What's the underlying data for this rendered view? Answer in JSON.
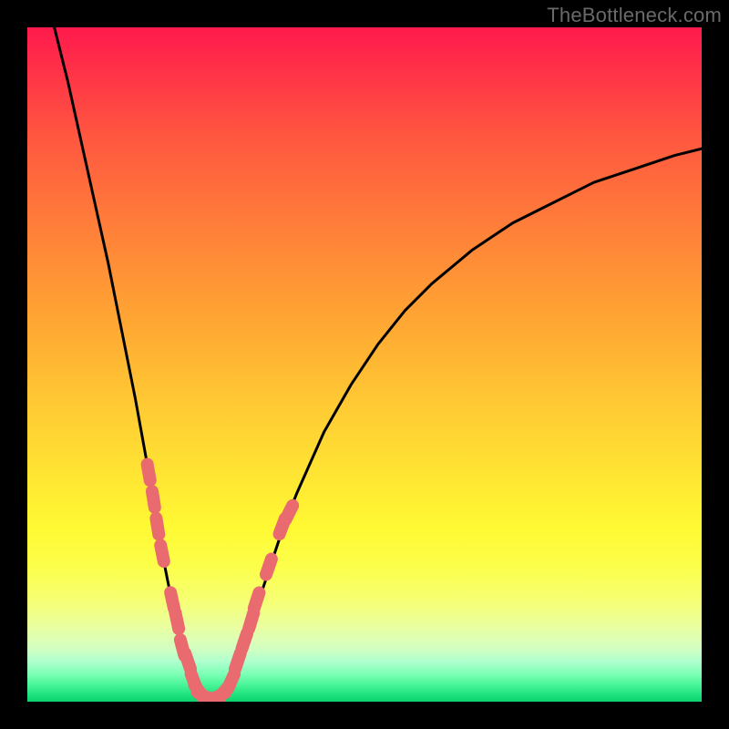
{
  "watermark_text": "TheBottleneck.com",
  "colors": {
    "frame": "#000000",
    "curve_stroke": "#000000",
    "marker_fill": "#e96a6f",
    "marker_stroke": "#c85155",
    "gradient_top": "#ff1a4d",
    "gradient_bottom": "#0cd371"
  },
  "chart_data": {
    "type": "line",
    "title": "",
    "xlabel": "",
    "ylabel": "",
    "xlim": [
      0,
      100
    ],
    "ylim": [
      0,
      100
    ],
    "legend": false,
    "grid": false,
    "note": "Axes unlabeled; values estimated from curve position. y is visual height within the gradient (0 = bottom/green, 100 = top/red).",
    "series": [
      {
        "name": "left-branch",
        "x": [
          4,
          6,
          8,
          10,
          12,
          14,
          16,
          18,
          19,
          20,
          21,
          22,
          23,
          24,
          25
        ],
        "y": [
          100,
          92,
          83,
          74,
          65,
          55,
          45,
          34,
          28,
          22,
          17,
          12,
          8,
          5,
          2
        ]
      },
      {
        "name": "valley",
        "x": [
          25,
          26,
          27,
          28,
          29,
          30
        ],
        "y": [
          2,
          1,
          0.5,
          0.5,
          1,
          2
        ]
      },
      {
        "name": "right-branch",
        "x": [
          30,
          32,
          34,
          36,
          38,
          40,
          44,
          48,
          52,
          56,
          60,
          66,
          72,
          78,
          84,
          90,
          96,
          100
        ],
        "y": [
          2,
          8,
          14,
          20,
          26,
          31,
          40,
          47,
          53,
          58,
          62,
          67,
          71,
          74,
          77,
          79,
          81,
          82
        ]
      }
    ],
    "markers": {
      "name": "highlighted-points",
      "note": "Pink capsule-shaped markers clustered near the valley on both branches.",
      "points": [
        {
          "x": 18.0,
          "y": 34
        },
        {
          "x": 18.7,
          "y": 30
        },
        {
          "x": 19.3,
          "y": 26
        },
        {
          "x": 20.0,
          "y": 22
        },
        {
          "x": 21.5,
          "y": 15
        },
        {
          "x": 22.2,
          "y": 12
        },
        {
          "x": 23.0,
          "y": 8
        },
        {
          "x": 23.8,
          "y": 6
        },
        {
          "x": 24.7,
          "y": 3
        },
        {
          "x": 25.5,
          "y": 1.5
        },
        {
          "x": 26.3,
          "y": 0.8
        },
        {
          "x": 27.3,
          "y": 0.5
        },
        {
          "x": 28.3,
          "y": 0.8
        },
        {
          "x": 29.2,
          "y": 1.5
        },
        {
          "x": 30.2,
          "y": 3
        },
        {
          "x": 31.2,
          "y": 6
        },
        {
          "x": 32.2,
          "y": 9
        },
        {
          "x": 33.2,
          "y": 12
        },
        {
          "x": 34.0,
          "y": 15
        },
        {
          "x": 35.8,
          "y": 20
        },
        {
          "x": 37.8,
          "y": 26
        },
        {
          "x": 38.8,
          "y": 28
        }
      ]
    }
  }
}
